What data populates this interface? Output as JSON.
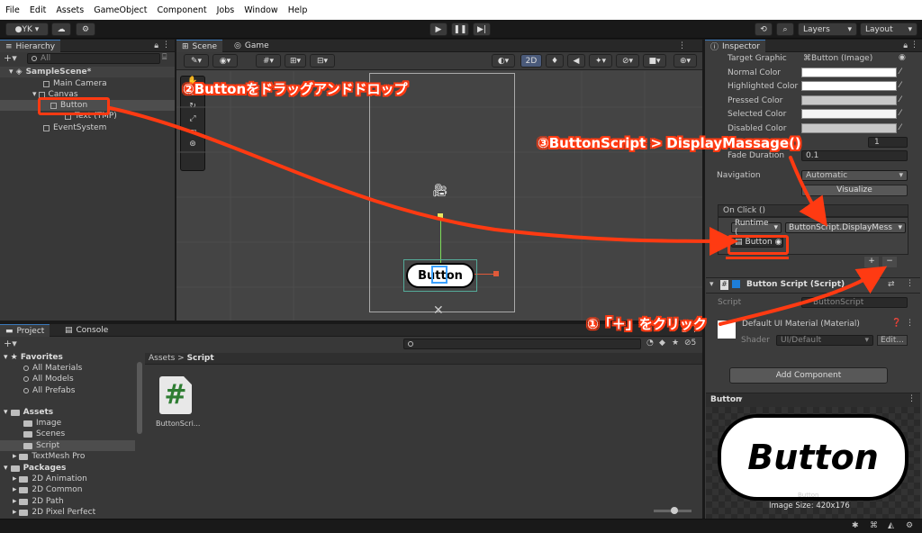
{
  "menu": [
    "File",
    "Edit",
    "Assets",
    "GameObject",
    "Component",
    "Jobs",
    "Window",
    "Help"
  ],
  "toolbar": {
    "account": "YK",
    "layers": "Layers",
    "layout": "Layout"
  },
  "hierarchy": {
    "tab": "Hierarchy",
    "search_placeholder": "All",
    "items": [
      "SampleScene*",
      "Main Camera",
      "Canvas",
      "Button",
      "Text (TMP)",
      "EventSystem"
    ]
  },
  "scene": {
    "tab_scene": "Scene",
    "tab_game": "Game",
    "mode_2d": "2D",
    "button_text": "Button"
  },
  "inspector": {
    "tab": "Inspector",
    "target_graphic_label": "Target Graphic",
    "target_graphic_value": "Button (Image)",
    "color_labels": [
      "Normal Color",
      "Highlighted Color",
      "Pressed Color",
      "Selected Color",
      "Disabled Color"
    ],
    "multiplier_value": "1",
    "fade_label": "Fade Duration",
    "fade_value": "0.1",
    "navigation_label": "Navigation",
    "navigation_value": "Automatic",
    "visualize": "Visualize",
    "onclick": "On Click ()",
    "runtime": "Runtime (",
    "function": "ButtonScript.DisplayMess",
    "object": "Button",
    "plus": "+",
    "minus": "−",
    "script_component": "Button Script (Script)",
    "script_label": "Script",
    "script_value": "ButtonScript",
    "material": "Default UI Material (Material)",
    "shader_label": "Shader",
    "shader_value": "UI/Default",
    "edit": "Edit...",
    "add_component": "Add Component",
    "preview_label": "Button",
    "preview_text": "Button",
    "preview_caption": "Button",
    "image_size": "Image Size: 420x176"
  },
  "project": {
    "tab_project": "Project",
    "tab_console": "Console",
    "favorites": "Favorites",
    "fav_items": [
      "All Materials",
      "All Models",
      "All Prefabs"
    ],
    "assets": "Assets",
    "asset_items": [
      "Image",
      "Scenes",
      "Script",
      "TextMesh Pro"
    ],
    "packages": "Packages",
    "package_items": [
      "2D Animation",
      "2D Common",
      "2D Path",
      "2D Pixel Perfect"
    ],
    "breadcrumb_root": "Assets",
    "breadcrumb_leaf": "Script",
    "file_name": "ButtonScri...",
    "badge": "5"
  },
  "annotations": {
    "step2": "②Buttonをドラッグアンドドロップ",
    "step3": "③ButtonScript > DisplayMassage()",
    "step1": "①「＋」をクリック"
  },
  "colors": {
    "annotation": "#ff3a12",
    "accent": "#3a79bb"
  }
}
